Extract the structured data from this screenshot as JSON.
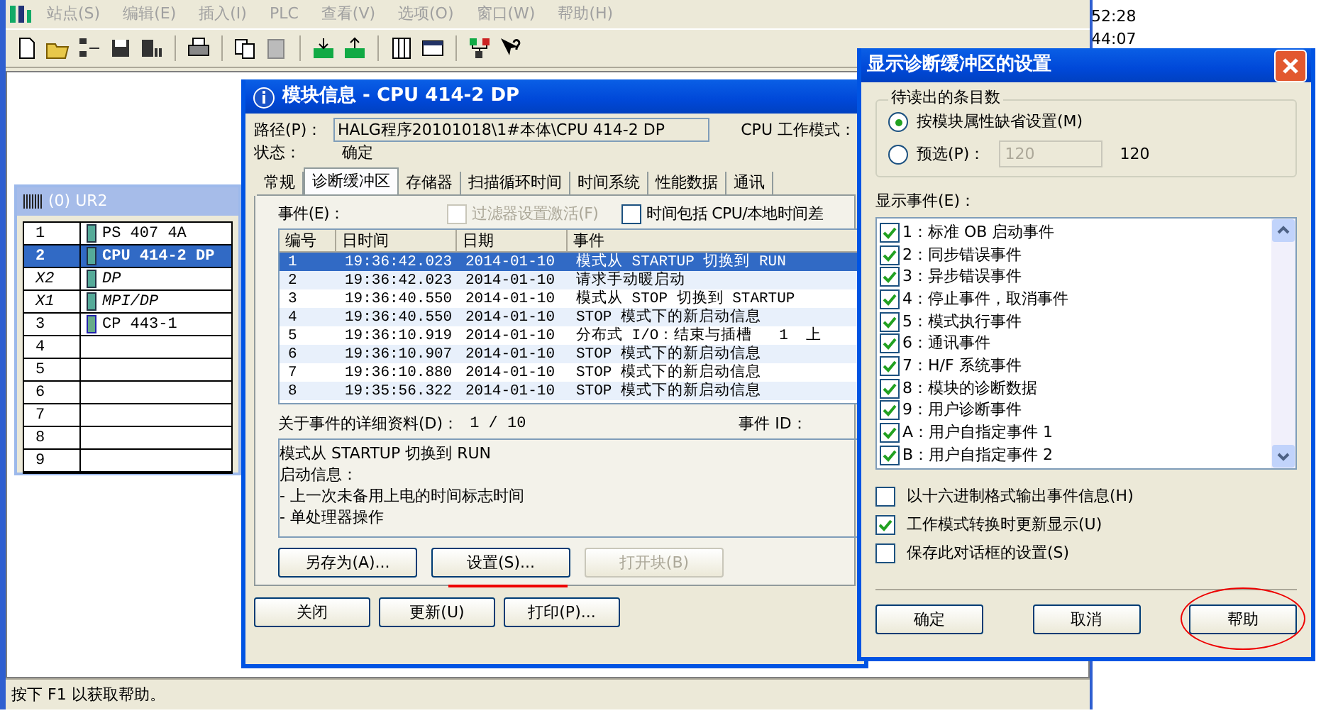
{
  "main_window": {
    "menu": [
      "站点(S)",
      "编辑(E)",
      "插入(I)",
      "PLC",
      "查看(V)",
      "选项(O)",
      "窗口(W)",
      "帮助(H)"
    ],
    "status_bar": "按下 F1 以获取帮助。"
  },
  "background_texts": [
    "52:28",
    "44:07"
  ],
  "rack_window": {
    "title": "(0) UR2",
    "rows": [
      {
        "slot": "1",
        "module": "PS 407 4A",
        "kind": "module",
        "selected": false
      },
      {
        "slot": "2",
        "module": "CPU 414-2 DP",
        "kind": "module",
        "selected": true
      },
      {
        "slot": "X2",
        "module": "DP",
        "kind": "interface",
        "selected": false
      },
      {
        "slot": "X1",
        "module": "MPI/DP",
        "kind": "interface",
        "selected": false
      },
      {
        "slot": "3",
        "module": "CP 443-1",
        "kind": "cp",
        "selected": false
      },
      {
        "slot": "4",
        "kind": "empty",
        "selected": false
      },
      {
        "slot": "5",
        "kind": "empty",
        "selected": false
      },
      {
        "slot": "6",
        "kind": "empty",
        "selected": false
      },
      {
        "slot": "7",
        "kind": "empty",
        "selected": false
      },
      {
        "slot": "8",
        "kind": "empty",
        "selected": false
      },
      {
        "slot": "9",
        "kind": "empty",
        "selected": false
      }
    ]
  },
  "module_info": {
    "title": "模块信息 - CPU 414-2 DP",
    "path_label": "路径(P)：",
    "path": "HALG程序20101018\\1#本体\\CPU 414-2 DP",
    "cpu_mode_label": "CPU 工作模式：",
    "status_label": "状态：",
    "status": "确定",
    "tabs": [
      {
        "label": "常规",
        "selected": false
      },
      {
        "label": "诊断缓冲区",
        "selected": true
      },
      {
        "label": "存储器",
        "selected": false
      },
      {
        "label": "扫描循环时间",
        "selected": false
      },
      {
        "label": "时间系统",
        "selected": false
      },
      {
        "label": "性能数据",
        "selected": false
      },
      {
        "label": "通讯",
        "selected": false
      }
    ],
    "events_label": "事件(E)：",
    "filter_checkbox": {
      "label": "过滤器设置激活(F)",
      "checked": false,
      "disabled": true
    },
    "time_checkbox": {
      "label": "时间包括 CPU/本地时间差",
      "checked": false,
      "disabled": false
    },
    "table": {
      "columns": [
        "编号",
        "日时间",
        "日期",
        "事件"
      ],
      "rows": [
        {
          "cells": [
            "1",
            "19:36:42.023",
            "2014-01-10",
            "模式从 STARTUP 切换到 RUN"
          ],
          "selected": true
        },
        {
          "cells": [
            "2",
            "19:36:42.023",
            "2014-01-10",
            "请求手动暖启动"
          ],
          "selected": false
        },
        {
          "cells": [
            "3",
            "19:36:40.550",
            "2014-01-10",
            "模式从 STOP 切换到 STARTUP"
          ],
          "selected": false
        },
        {
          "cells": [
            "4",
            "19:36:40.550",
            "2014-01-10",
            "STOP 模式下的新启动信息"
          ],
          "selected": false
        },
        {
          "cells": [
            "5",
            "19:36:10.919",
            "2014-01-10",
            "分布式 I/O：结束与插槽   1  上"
          ],
          "selected": false
        },
        {
          "cells": [
            "6",
            "19:36:10.907",
            "2014-01-10",
            "STOP 模式下的新启动信息"
          ],
          "selected": false
        },
        {
          "cells": [
            "7",
            "19:36:10.880",
            "2014-01-10",
            "STOP 模式下的新启动信息"
          ],
          "selected": false
        },
        {
          "cells": [
            "8",
            "19:35:56.322",
            "2014-01-10",
            "STOP 模式下的新启动信息"
          ],
          "selected": false
        }
      ]
    },
    "details_label": "关于事件的详细资料(D)：",
    "details_count": "1 / 10",
    "event_id_label": "事件 ID：",
    "details_lines": [
      "模式从 STARTUP 切换到 RUN",
      "启动信息：",
      "- 上一次未备用上电的时间标志时间",
      "- 单处理器操作"
    ],
    "buttons": [
      {
        "label": "另存为(A)...",
        "disabled": false
      },
      {
        "label": "设置(S)...",
        "disabled": false
      },
      {
        "label": "打开块(B)",
        "disabled": true
      }
    ],
    "bottom_buttons": [
      "关闭",
      "更新(U)",
      "打印(P)..."
    ]
  },
  "settings_dialog": {
    "title": "显示诊断缓冲区的设置",
    "group_title": "待读出的条目数",
    "radios": [
      {
        "label": "按模块属性缺省设置(M)",
        "selected": true
      },
      {
        "label": "预选(P)：",
        "selected": false
      }
    ],
    "preset_value": "120",
    "preset_max": "120",
    "events_label": "显示事件(E)：",
    "events": [
      {
        "label": "1：标准 OB 启动事件",
        "checked": true
      },
      {
        "label": "2：同步错误事件",
        "checked": true
      },
      {
        "label": "3：异步错误事件",
        "checked": true
      },
      {
        "label": "4：停止事件，取消事件",
        "checked": true
      },
      {
        "label": "5：模式执行事件",
        "checked": true
      },
      {
        "label": "6：通讯事件",
        "checked": true
      },
      {
        "label": "7：H/F 系统事件",
        "checked": true
      },
      {
        "label": "8：模块的诊断数据",
        "checked": true
      },
      {
        "label": "9：用户诊断事件",
        "checked": true
      },
      {
        "label": "A：用户自指定事件 1",
        "checked": true
      },
      {
        "label": "B：用户自指定事件 2",
        "checked": true
      }
    ],
    "options": [
      {
        "label": "以十六进制格式输出事件信息(H)",
        "checked": false
      },
      {
        "label": "工作模式转换时更新显示(U)",
        "checked": true
      },
      {
        "label": "保存此对话框的设置(S)",
        "checked": false
      }
    ],
    "buttons": [
      "确定",
      "取消",
      "帮助"
    ]
  }
}
